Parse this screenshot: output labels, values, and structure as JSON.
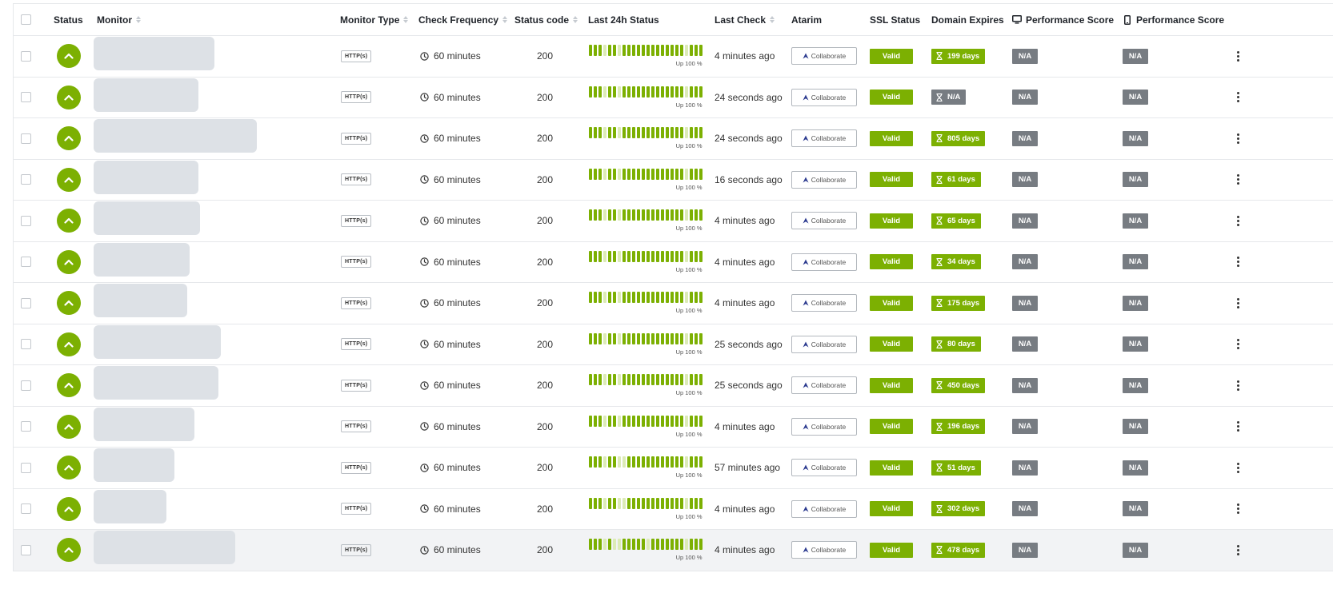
{
  "headers": {
    "status": "Status",
    "monitor": "Monitor",
    "monitor_type": "Monitor Type",
    "check_frequency": "Check Frequency",
    "status_code": "Status code",
    "last_24h": "Last 24h Status",
    "last_check": "Last Check",
    "atarim": "Atarim",
    "ssl_status": "SSL Status",
    "domain_expires": "Domain Expires",
    "perf_desktop": "Performance Score",
    "perf_mobile": "Performance Score"
  },
  "icons": {
    "status_up": "chevron-up-icon",
    "clock": "clock-icon",
    "atarim": "atarim-logo-icon",
    "hourglass": "hourglass-icon",
    "desktop": "monitor-icon",
    "mobile": "phone-icon",
    "menu": "kebab-menu-icon"
  },
  "colors": {
    "up_green": "#7cb002",
    "uptime_light": "#dcebb6",
    "na_gray": "#777c82",
    "atarim_blue": "#2b3a8f"
  },
  "rows": [
    {
      "type": "HTTP(s)",
      "frequency": "60 minutes",
      "status_code": "200",
      "uptime": "Up 100 %",
      "last_check": "4 minutes ago",
      "atarim": "Collaborate",
      "ssl": "Valid",
      "domain_expires": "199 days",
      "domain_na": false,
      "perf_desktop": "N/A",
      "perf_mobile": "N/A"
    },
    {
      "type": "HTTP(s)",
      "frequency": "60 minutes",
      "status_code": "200",
      "uptime": "Up 100 %",
      "last_check": "24 seconds ago",
      "atarim": "Collaborate",
      "ssl": "Valid",
      "domain_expires": "N/A",
      "domain_na": true,
      "perf_desktop": "N/A",
      "perf_mobile": "N/A"
    },
    {
      "type": "HTTP(s)",
      "frequency": "60 minutes",
      "status_code": "200",
      "uptime": "Up 100 %",
      "last_check": "24 seconds ago",
      "atarim": "Collaborate",
      "ssl": "Valid",
      "domain_expires": "805 days",
      "domain_na": false,
      "perf_desktop": "N/A",
      "perf_mobile": "N/A"
    },
    {
      "type": "HTTP(s)",
      "frequency": "60 minutes",
      "status_code": "200",
      "uptime": "Up 100 %",
      "last_check": "16 seconds ago",
      "atarim": "Collaborate",
      "ssl": "Valid",
      "domain_expires": "61 days",
      "domain_na": false,
      "perf_desktop": "N/A",
      "perf_mobile": "N/A"
    },
    {
      "type": "HTTP(s)",
      "frequency": "60 minutes",
      "status_code": "200",
      "uptime": "Up 100 %",
      "last_check": "4 minutes ago",
      "atarim": "Collaborate",
      "ssl": "Valid",
      "domain_expires": "65 days",
      "domain_na": false,
      "perf_desktop": "N/A",
      "perf_mobile": "N/A"
    },
    {
      "type": "HTTP(s)",
      "frequency": "60 minutes",
      "status_code": "200",
      "uptime": "Up 100 %",
      "last_check": "4 minutes ago",
      "atarim": "Collaborate",
      "ssl": "Valid",
      "domain_expires": "34 days",
      "domain_na": false,
      "perf_desktop": "N/A",
      "perf_mobile": "N/A"
    },
    {
      "type": "HTTP(s)",
      "frequency": "60 minutes",
      "status_code": "200",
      "uptime": "Up 100 %",
      "last_check": "4 minutes ago",
      "atarim": "Collaborate",
      "ssl": "Valid",
      "domain_expires": "175 days",
      "domain_na": false,
      "perf_desktop": "N/A",
      "perf_mobile": "N/A"
    },
    {
      "type": "HTTP(s)",
      "frequency": "60 minutes",
      "status_code": "200",
      "uptime": "Up 100 %",
      "last_check": "25 seconds ago",
      "atarim": "Collaborate",
      "ssl": "Valid",
      "domain_expires": "80 days",
      "domain_na": false,
      "perf_desktop": "N/A",
      "perf_mobile": "N/A"
    },
    {
      "type": "HTTP(s)",
      "frequency": "60 minutes",
      "status_code": "200",
      "uptime": "Up 100 %",
      "last_check": "25 seconds ago",
      "atarim": "Collaborate",
      "ssl": "Valid",
      "domain_expires": "450 days",
      "domain_na": false,
      "perf_desktop": "N/A",
      "perf_mobile": "N/A"
    },
    {
      "type": "HTTP(s)",
      "frequency": "60 minutes",
      "status_code": "200",
      "uptime": "Up 100 %",
      "last_check": "4 minutes ago",
      "atarim": "Collaborate",
      "ssl": "Valid",
      "domain_expires": "196 days",
      "domain_na": false,
      "perf_desktop": "N/A",
      "perf_mobile": "N/A"
    },
    {
      "type": "HTTP(s)",
      "frequency": "60 minutes",
      "status_code": "200",
      "uptime": "Up 100 %",
      "last_check": "57 minutes ago",
      "atarim": "Collaborate",
      "ssl": "Valid",
      "domain_expires": "51 days",
      "domain_na": false,
      "perf_desktop": "N/A",
      "perf_mobile": "N/A"
    },
    {
      "type": "HTTP(s)",
      "frequency": "60 minutes",
      "status_code": "200",
      "uptime": "Up 100 %",
      "last_check": "4 minutes ago",
      "atarim": "Collaborate",
      "ssl": "Valid",
      "domain_expires": "302 days",
      "domain_na": false,
      "perf_desktop": "N/A",
      "perf_mobile": "N/A"
    },
    {
      "type": "HTTP(s)",
      "frequency": "60 minutes",
      "status_code": "200",
      "uptime": "Up 100 %",
      "last_check": "4 minutes ago",
      "atarim": "Collaborate",
      "ssl": "Valid",
      "domain_expires": "478 days",
      "domain_na": false,
      "perf_desktop": "N/A",
      "perf_mobile": "N/A"
    }
  ]
}
